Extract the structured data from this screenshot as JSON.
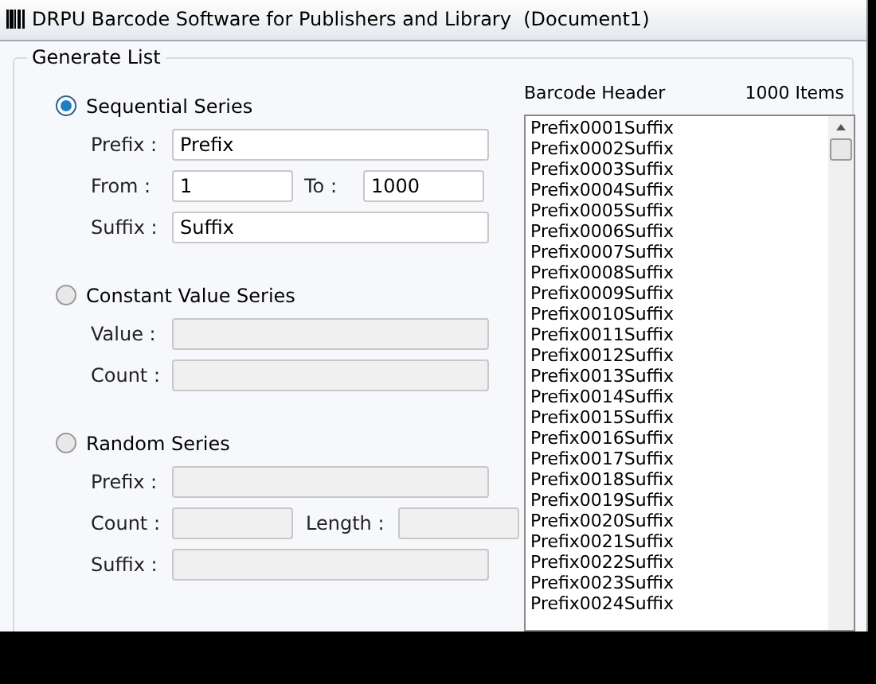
{
  "window": {
    "title": "DRPU Barcode Software for Publishers and Library  (Document1)"
  },
  "group": {
    "title": "Generate List"
  },
  "series": [
    {
      "label": "Sequential Series",
      "selected": true,
      "rows": [
        [
          {
            "label": "Prefix :",
            "value": "Prefix",
            "disabled": false
          }
        ],
        [
          {
            "label": "From :",
            "value": "1",
            "disabled": false
          },
          {
            "label": "To :",
            "value": "1000",
            "disabled": false
          }
        ],
        [
          {
            "label": "Suffix :",
            "value": "Suffix",
            "disabled": false
          }
        ]
      ]
    },
    {
      "label": "Constant Value Series",
      "selected": false,
      "rows": [
        [
          {
            "label": "Value :",
            "disabled": true
          }
        ],
        [
          {
            "label": "Count :",
            "disabled": true
          }
        ]
      ]
    },
    {
      "label": "Random Series",
      "selected": false,
      "rows": [
        [
          {
            "label": "Prefix :",
            "disabled": true
          }
        ],
        [
          {
            "label": "Count :",
            "disabled": true
          },
          {
            "label": "Length :",
            "disabled": true
          }
        ],
        [
          {
            "label": "Suffix :",
            "disabled": true
          }
        ]
      ]
    }
  ],
  "list": {
    "header": "Barcode Header",
    "count": "1000 Items",
    "items": [
      "Prefix0001Suffix",
      "Prefix0002Suffix",
      "Prefix0003Suffix",
      "Prefix0004Suffix",
      "Prefix0005Suffix",
      "Prefix0006Suffix",
      "Prefix0007Suffix",
      "Prefix0008Suffix",
      "Prefix0009Suffix",
      "Prefix0010Suffix",
      "Prefix0011Suffix",
      "Prefix0012Suffix",
      "Prefix0013Suffix",
      "Prefix0014Suffix",
      "Prefix0015Suffix",
      "Prefix0016Suffix",
      "Prefix0017Suffix",
      "Prefix0018Suffix",
      "Prefix0019Suffix",
      "Prefix0020Suffix",
      "Prefix0021Suffix",
      "Prefix0022Suffix",
      "Prefix0023Suffix",
      "Prefix0024Suffix"
    ]
  }
}
